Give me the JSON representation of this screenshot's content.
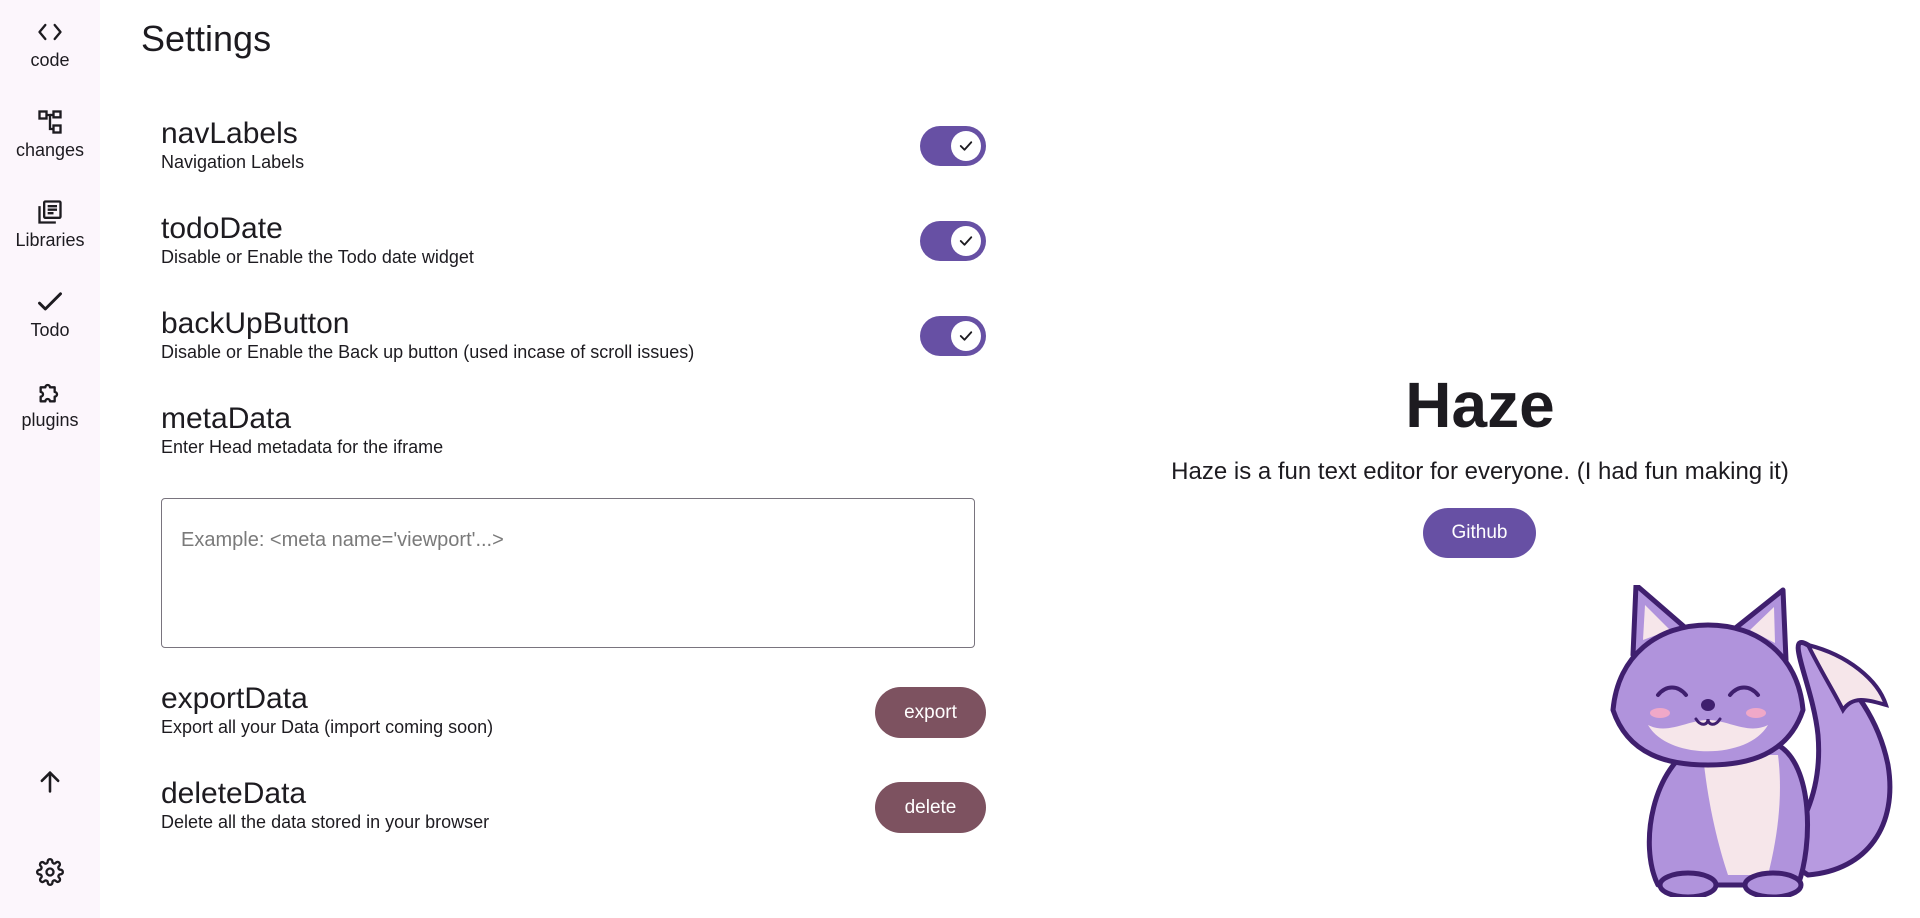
{
  "sidebar": {
    "items": [
      {
        "label": "code",
        "icon": "code-icon"
      },
      {
        "label": "changes",
        "icon": "changes-icon"
      },
      {
        "label": "Libraries",
        "icon": "libraries-icon"
      },
      {
        "label": "Todo",
        "icon": "check-icon"
      },
      {
        "label": "plugins",
        "icon": "puzzle-icon"
      }
    ],
    "bottom": [
      {
        "icon": "arrow-up-icon"
      },
      {
        "icon": "gear-icon"
      }
    ]
  },
  "main": {
    "title": "Settings",
    "settings": [
      {
        "name": "navLabels",
        "description": "Navigation Labels",
        "control": "toggle",
        "checked": true
      },
      {
        "name": "todoDate",
        "description": "Disable or Enable the Todo date widget",
        "control": "toggle",
        "checked": true
      },
      {
        "name": "backUpButton",
        "description": "Disable or Enable the Back up button (used incase of scroll issues)",
        "control": "toggle",
        "checked": true
      },
      {
        "name": "metaData",
        "description": "Enter Head metadata for the iframe",
        "control": "textarea",
        "placeholder": "Example: <meta name='viewport'...>",
        "value": ""
      },
      {
        "name": "exportData",
        "description": "Export all your Data (import coming soon)",
        "control": "button",
        "button_label": "export"
      },
      {
        "name": "deleteData",
        "description": "Delete all the data stored in your browser",
        "control": "button",
        "button_label": "delete"
      }
    ]
  },
  "about": {
    "title": "Haze",
    "tagline": "Haze is a fun text editor for everyone. (I had fun making it)",
    "github_label": "Github",
    "mascot": "fox-illustration"
  },
  "colors": {
    "primary": "#6750a4",
    "secondary_button": "#7d5260",
    "sidebar_bg": "#fcf6fc",
    "text": "#1d1b20"
  }
}
